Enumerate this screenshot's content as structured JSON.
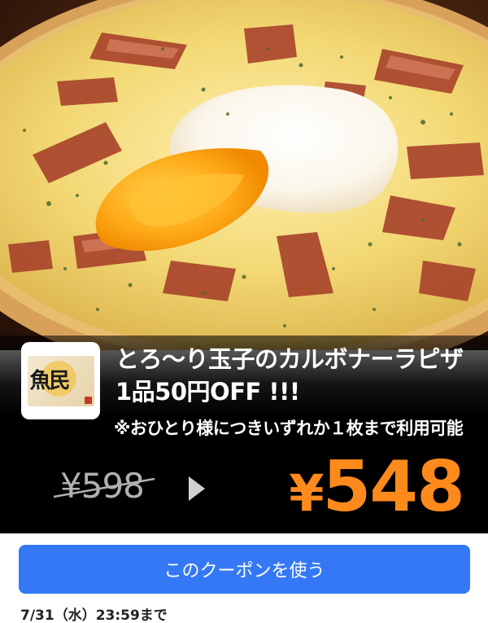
{
  "coupon": {
    "title_line1": "とろ〜り玉子のカルボナーラピザ",
    "title_line2": "1品50円OFF !!!",
    "note": "※おひとり様につきいずれか１枚まで利用可能",
    "old_price": "¥598",
    "new_price_yen": "¥",
    "new_price_value": "548",
    "accent_color": "#ff8a1c"
  },
  "logo": {
    "brand_text": "魚民"
  },
  "action": {
    "use_label": "このクーポンを使う"
  },
  "deadline": "7/31（水）23:59まで",
  "colors": {
    "button": "#3478f6",
    "band": "#000000"
  }
}
